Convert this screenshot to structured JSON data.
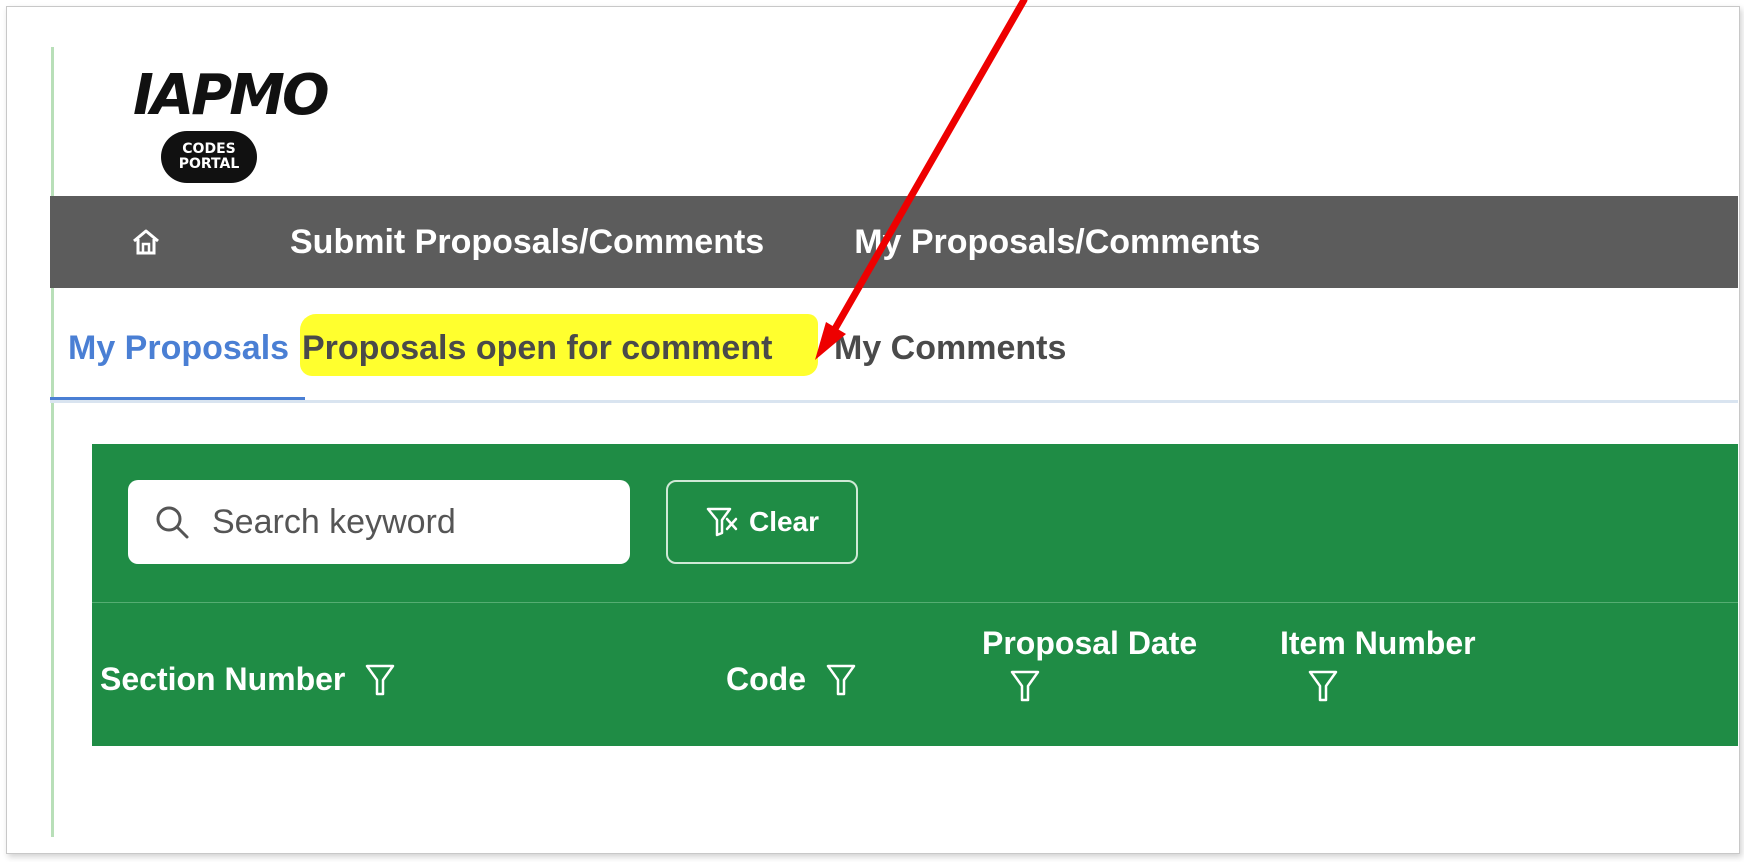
{
  "logo": {
    "wordmark": "IAPMO",
    "badge_line1": "CODES",
    "badge_line2": "PORTAL"
  },
  "nav": {
    "home_icon": "home-icon",
    "links": [
      "Submit Proposals/Comments",
      "My Proposals/Comments"
    ]
  },
  "tabs": {
    "items": [
      "My Proposals",
      "Proposals open for comment",
      "My Comments"
    ],
    "active": "My Proposals",
    "highlighted": "Proposals open for comment"
  },
  "toolbar": {
    "search_placeholder": "Search keyword",
    "clear_label": "Clear"
  },
  "table": {
    "columns": [
      "Section Number",
      "Code",
      "Proposal Date",
      "Item Number"
    ]
  },
  "colors": {
    "nav_bg": "#5c5c5c",
    "green": "#1f8c45",
    "active_tab": "#4a7fd4",
    "highlight": "#ffff2e",
    "annotation_arrow": "#ee0000"
  }
}
